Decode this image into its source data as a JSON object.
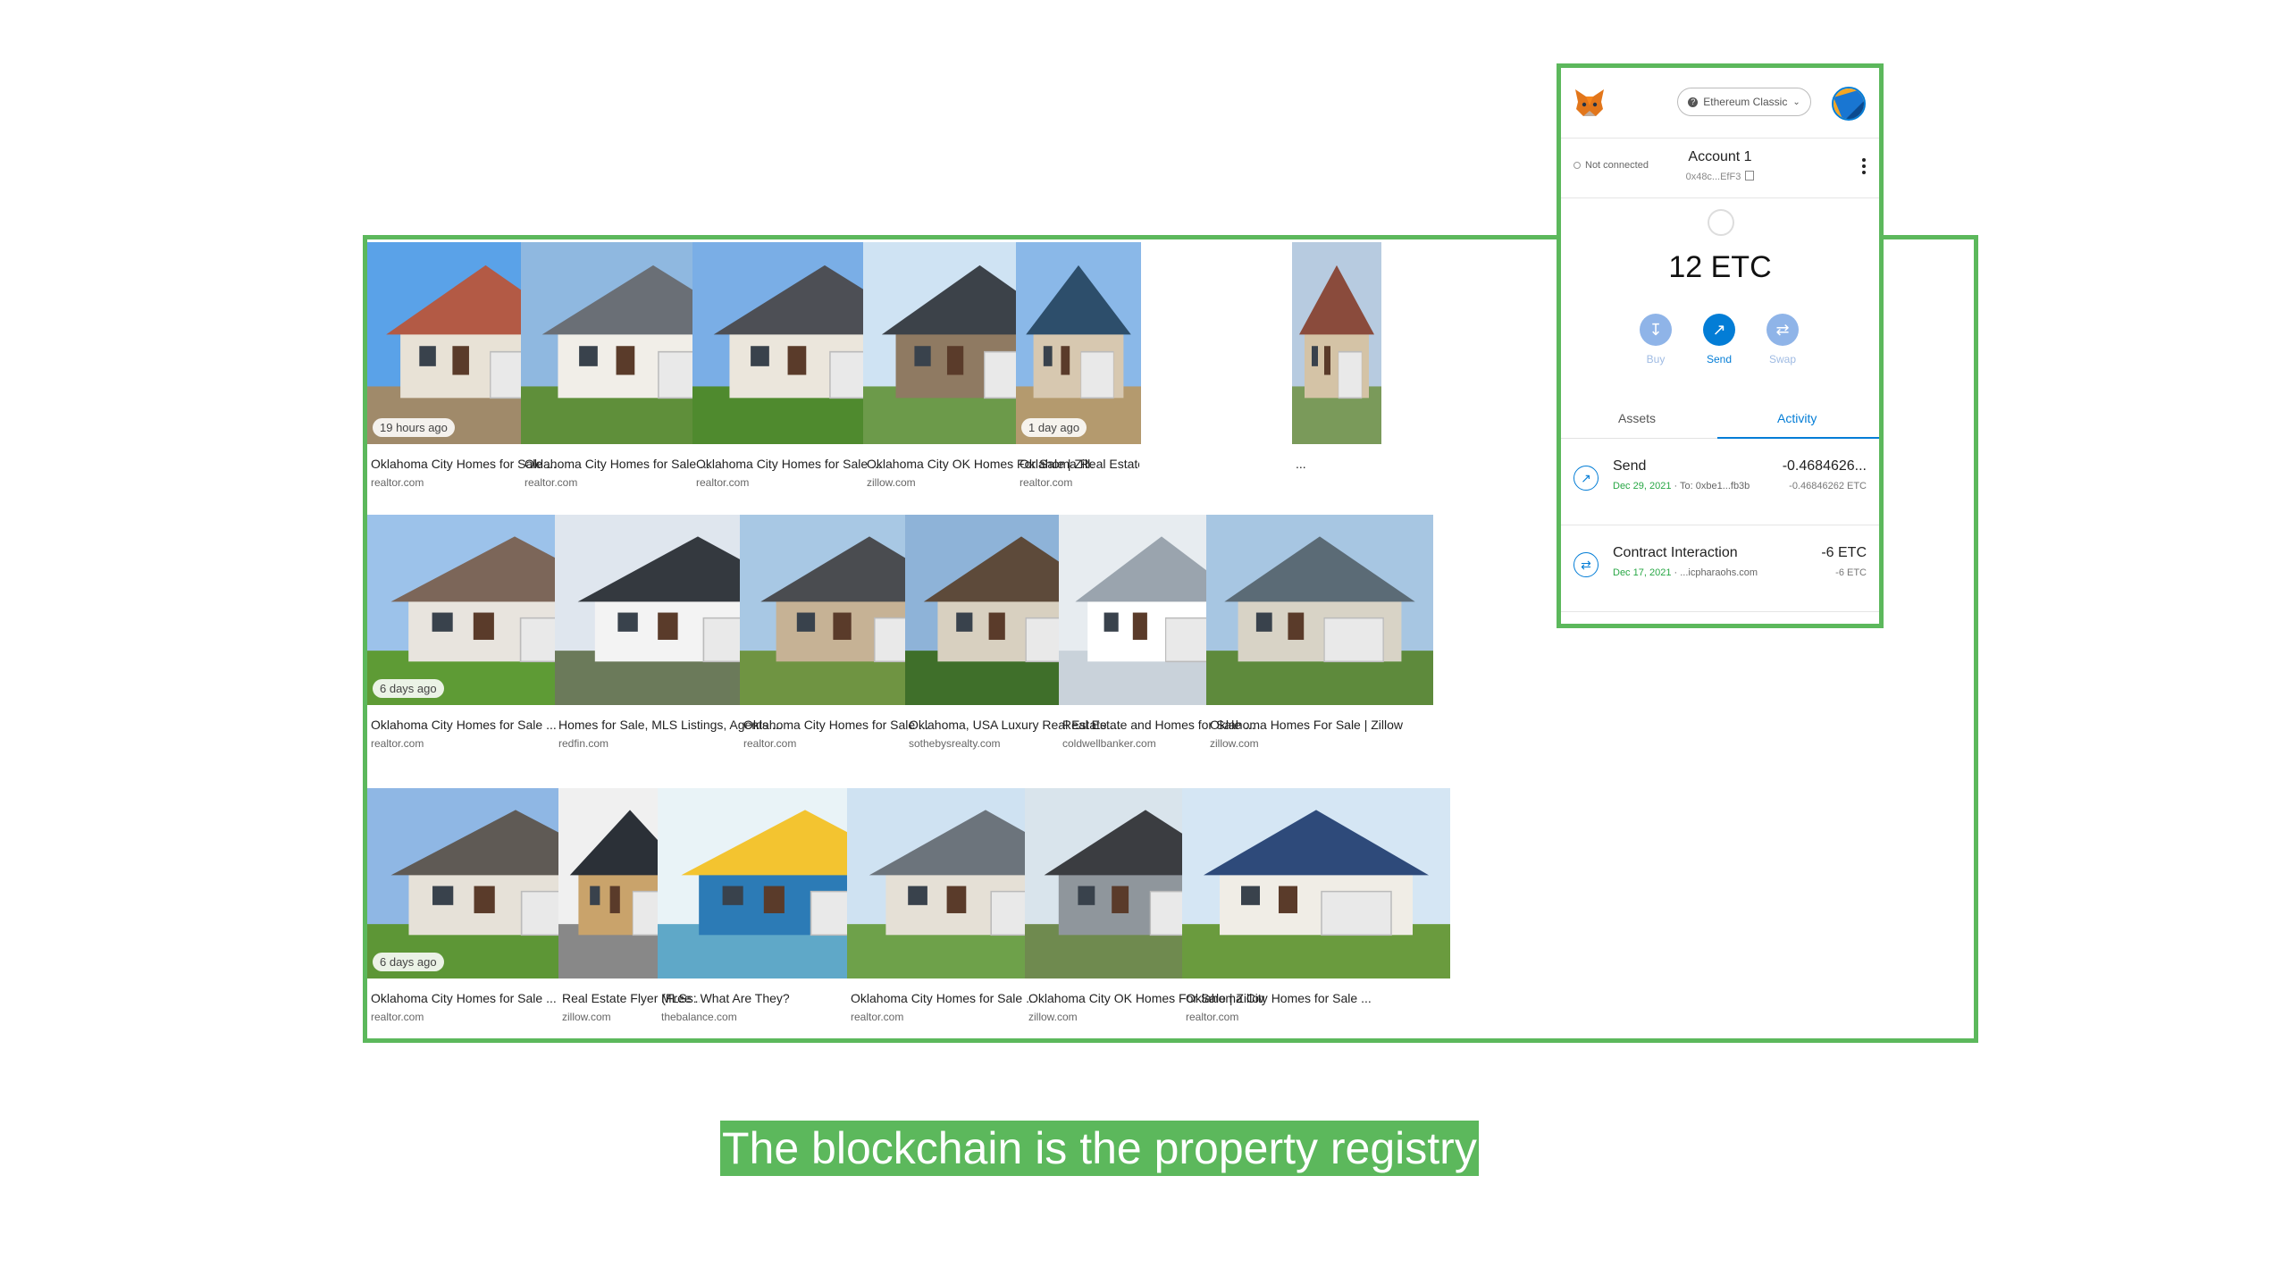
{
  "caption": "The blockchain is the property registry",
  "colors": {
    "frame": "#5cb85c",
    "accent": "#037dd6",
    "success": "#28a745"
  },
  "results": [
    {
      "caption": "Oklahoma City Homes for Sale ...",
      "source": "realtor.com",
      "ago": "19 hours ago"
    },
    {
      "caption": "Oklahoma City Homes for Sale ...",
      "source": "realtor.com",
      "ago": ""
    },
    {
      "caption": "Oklahoma City Homes for Sale ...",
      "source": "realtor.com",
      "ago": ""
    },
    {
      "caption": "Oklahoma City OK Homes For Sale | Zill...",
      "source": "zillow.com",
      "ago": ""
    },
    {
      "caption": "Oklahoma Real Estate ...",
      "source": "realtor.com",
      "ago": "1 day ago"
    },
    {
      "caption": "...",
      "source": "",
      "ago": ""
    },
    {
      "caption": "Oklahoma City Homes for Sale ...",
      "source": "realtor.com",
      "ago": "6 days ago"
    },
    {
      "caption": "Homes for Sale, MLS Listings, Agents ...",
      "source": "redfin.com",
      "ago": ""
    },
    {
      "caption": "Oklahoma City Homes for Sale ...",
      "source": "realtor.com",
      "ago": ""
    },
    {
      "caption": "Oklahoma, USA Luxury Real Estate ...",
      "source": "sothebysrealty.com",
      "ago": ""
    },
    {
      "caption": "Real Estate and Homes for Sale ...",
      "source": "coldwellbanker.com",
      "ago": ""
    },
    {
      "caption": "Oklahoma Homes For Sale | Zillow",
      "source": "zillow.com",
      "ago": ""
    },
    {
      "caption": "Oklahoma City Homes for Sale ...",
      "source": "realtor.com",
      "ago": "6 days ago"
    },
    {
      "caption": "Real Estate Flyer (Free ...",
      "source": "zillow.com",
      "ago": ""
    },
    {
      "caption": "MLSs: What Are They?",
      "source": "thebalance.com",
      "ago": ""
    },
    {
      "caption": "Oklahoma City Homes for Sale ...",
      "source": "realtor.com",
      "ago": ""
    },
    {
      "caption": "Oklahoma City OK Homes For Sale | Zillow",
      "source": "zillow.com",
      "ago": ""
    },
    {
      "caption": "Oklahoma City Homes for Sale ...",
      "source": "realtor.com",
      "ago": ""
    }
  ],
  "wallet": {
    "network": "Ethereum Classic",
    "account_name": "Account 1",
    "account_address": "0x48c...EfF3",
    "connection_status": "Not connected",
    "balance": "12 ETC",
    "actions": [
      {
        "label": "Buy",
        "icon": "download-icon"
      },
      {
        "label": "Send",
        "icon": "arrow-up-right-icon"
      },
      {
        "label": "Swap",
        "icon": "swap-icon"
      }
    ],
    "tabs": [
      "Assets",
      "Activity"
    ],
    "active_tab": "Activity",
    "transactions": [
      {
        "title": "Send",
        "date": "Dec 29, 2021",
        "detail": " · To: 0xbe1...fb3b",
        "amount": "-0.4684626...",
        "amount_sub": "-0.46846262 ETC",
        "icon": "arrow-up-right-icon"
      },
      {
        "title": "Contract Interaction",
        "date": "Dec 17, 2021",
        "detail": " · ...icpharaohs.com",
        "amount": "-6 ETC",
        "amount_sub": "-6 ETC",
        "icon": "swap-icon"
      }
    ]
  }
}
